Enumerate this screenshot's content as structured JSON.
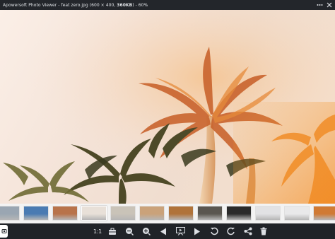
{
  "window": {
    "app_name": "Apowersoft Photo Viewer",
    "separator": " - ",
    "file_name": "feat zero.jpg",
    "dimensions": "(600 × 400,",
    "file_size": "360KB",
    "dims_close": ")",
    "zoom": "- 60%",
    "more_icon": "ellipsis-icon",
    "close_icon": "close-icon"
  },
  "thumbnails": {
    "count_visible": 15,
    "active_index": 3,
    "colors": [
      "#9aa6b2",
      "#4a7bb2",
      "#b8734a",
      "#e8e0d8",
      "#c9c3b8",
      "#caa27a",
      "#b0733a",
      "#5a5650",
      "#2a2a2a",
      "#e2e2e4",
      "#e9e9ea",
      "#d07a34",
      "#3a6fa8",
      "#3c4a4c",
      "#2f6e9a"
    ]
  },
  "toolbar": {
    "actual_size_label": "1:1",
    "colors": {
      "icon": "#dcdfe4",
      "bg": "#202328"
    }
  }
}
